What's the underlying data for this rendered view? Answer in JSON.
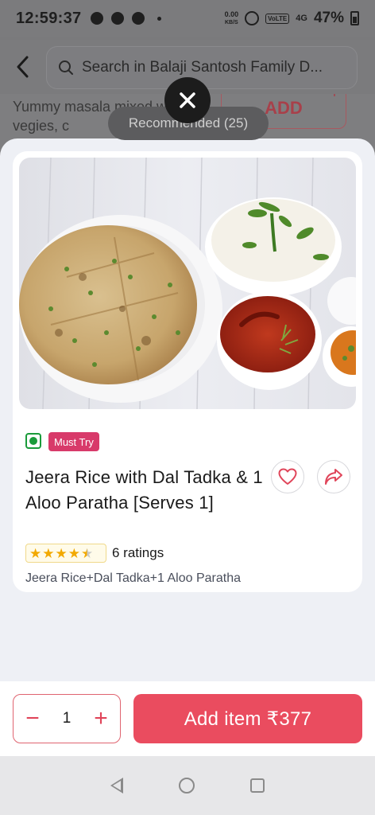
{
  "status_bar": {
    "time": "12:59:37",
    "data_speed": "0.00",
    "data_unit": "KB/S",
    "volte": "VoLTE",
    "network": "4G",
    "battery": "47%"
  },
  "header": {
    "search_placeholder": "Search in Balaji Santosh Family D..."
  },
  "background_item": {
    "description": "Yummy masala mixed with vegies, c",
    "add_label": "ADD",
    "plus": "+"
  },
  "recommended_label": "Recommended (25)",
  "item": {
    "tag": "Must Try",
    "title": "Jeera Rice with Dal Tadka & 1 Aloo Paratha [Serves 1]",
    "rating_value": 4.5,
    "rating_text": "6 ratings",
    "description": "Jeera Rice+Dal Tadka+1 Aloo Paratha"
  },
  "cart": {
    "minus": "−",
    "quantity": "1",
    "plus": "+",
    "add_label": "Add item ₹377"
  },
  "colors": {
    "accent": "#ea4c5f",
    "veg": "#1a9b3a",
    "tag": "#d83a6a",
    "star": "#f2a900"
  },
  "icons": [
    "back-arrow-icon",
    "search-icon",
    "close-icon",
    "veg-icon",
    "heart-icon",
    "share-icon",
    "star-icon"
  ]
}
